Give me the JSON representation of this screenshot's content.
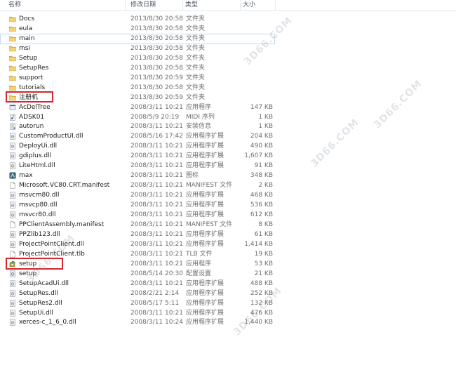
{
  "columns": {
    "name": "名称",
    "date": "修改日期",
    "type": "类型",
    "size": "大小"
  },
  "files": [
    {
      "name": "Docs",
      "date": "2013/8/30 20:58",
      "type": "文件夹",
      "size": "",
      "icon": "folder-icon"
    },
    {
      "name": "eula",
      "date": "2013/8/30 20:58",
      "type": "文件夹",
      "size": "",
      "icon": "folder-icon"
    },
    {
      "name": "main",
      "date": "2013/8/30 20:58",
      "type": "文件夹",
      "size": "",
      "icon": "folder-icon"
    },
    {
      "name": "msi",
      "date": "2013/8/30 20:58",
      "type": "文件夹",
      "size": "",
      "icon": "folder-icon"
    },
    {
      "name": "Setup",
      "date": "2013/8/30 20:58",
      "type": "文件夹",
      "size": "",
      "icon": "folder-icon"
    },
    {
      "name": "SetupRes",
      "date": "2013/8/30 20:58",
      "type": "文件夹",
      "size": "",
      "icon": "folder-icon"
    },
    {
      "name": "support",
      "date": "2013/8/30 20:59",
      "type": "文件夹",
      "size": "",
      "icon": "folder-icon"
    },
    {
      "name": "tutorials",
      "date": "2013/8/30 20:58",
      "type": "文件夹",
      "size": "",
      "icon": "folder-icon"
    },
    {
      "name": "注册机",
      "date": "2013/8/30 20:59",
      "type": "文件夹",
      "size": "",
      "icon": "folder-icon"
    },
    {
      "name": "AcDelTree",
      "date": "2008/3/11 10:21",
      "type": "应用程序",
      "size": "147 KB",
      "icon": "app-icon"
    },
    {
      "name": "ADSK01",
      "date": "2008/5/9 20:19",
      "type": "MIDI 序列",
      "size": "1 KB",
      "icon": "midi-icon"
    },
    {
      "name": "autorun",
      "date": "2008/3/11 10:21",
      "type": "安装信息",
      "size": "1 KB",
      "icon": "setup-info-icon"
    },
    {
      "name": "CustomProductUI.dll",
      "date": "2008/5/16 17:42",
      "type": "应用程序扩展",
      "size": "204 KB",
      "icon": "dll-icon"
    },
    {
      "name": "DeployUi.dll",
      "date": "2008/3/11 10:21",
      "type": "应用程序扩展",
      "size": "490 KB",
      "icon": "dll-icon"
    },
    {
      "name": "gdiplus.dll",
      "date": "2008/3/11 10:21",
      "type": "应用程序扩展",
      "size": "1,607 KB",
      "icon": "dll-icon"
    },
    {
      "name": "LiteHtml.dll",
      "date": "2008/3/11 10:21",
      "type": "应用程序扩展",
      "size": "91 KB",
      "icon": "dll-icon"
    },
    {
      "name": "max",
      "date": "2008/3/11 10:21",
      "type": "图标",
      "size": "348 KB",
      "icon": "max-icon"
    },
    {
      "name": "Microsoft.VC80.CRT.manifest",
      "date": "2008/3/11 10:21",
      "type": "MANIFEST 文件",
      "size": "2 KB",
      "icon": "file-icon"
    },
    {
      "name": "msvcm80.dll",
      "date": "2008/3/11 10:21",
      "type": "应用程序扩展",
      "size": "468 KB",
      "icon": "dll-icon"
    },
    {
      "name": "msvcp80.dll",
      "date": "2008/3/11 10:21",
      "type": "应用程序扩展",
      "size": "536 KB",
      "icon": "dll-icon"
    },
    {
      "name": "msvcr80.dll",
      "date": "2008/3/11 10:21",
      "type": "应用程序扩展",
      "size": "612 KB",
      "icon": "dll-icon"
    },
    {
      "name": "PPClientAssembly.manifest",
      "date": "2008/3/11 10:21",
      "type": "MANIFEST 文件",
      "size": "8 KB",
      "icon": "file-icon"
    },
    {
      "name": "PPZlib123.dll",
      "date": "2008/3/11 10:21",
      "type": "应用程序扩展",
      "size": "61 KB",
      "icon": "dll-icon"
    },
    {
      "name": "ProjectPointClient.dll",
      "date": "2008/3/11 10:21",
      "type": "应用程序扩展",
      "size": "1,414 KB",
      "icon": "dll-icon"
    },
    {
      "name": "ProjectPointClient.tlb",
      "date": "2008/3/11 10:21",
      "type": "TLB 文件",
      "size": "19 KB",
      "icon": "file-icon"
    },
    {
      "name": "setup",
      "date": "2008/3/11 10:21",
      "type": "应用程序",
      "size": "53 KB",
      "icon": "setup-exe-icon"
    },
    {
      "name": "setup",
      "date": "2008/5/14 20:30",
      "type": "配置设置",
      "size": "21 KB",
      "icon": "config-icon"
    },
    {
      "name": "SetupAcadUi.dll",
      "date": "2008/3/11 10:21",
      "type": "应用程序扩展",
      "size": "488 KB",
      "icon": "dll-icon"
    },
    {
      "name": "SetupRes.dll",
      "date": "2008/2/21 2:14",
      "type": "应用程序扩展",
      "size": "252 KB",
      "icon": "dll-icon"
    },
    {
      "name": "SetupRes2.dll",
      "date": "2008/5/17 5:11",
      "type": "应用程序扩展",
      "size": "132 KB",
      "icon": "dll-icon"
    },
    {
      "name": "SetupUi.dll",
      "date": "2008/3/11 10:21",
      "type": "应用程序扩展",
      "size": "476 KB",
      "icon": "dll-icon"
    },
    {
      "name": "xerces-c_1_6_0.dll",
      "date": "2008/3/11 10:24",
      "type": "应用程序扩展",
      "size": "1,440 KB",
      "icon": "dll-icon"
    }
  ],
  "colors": {
    "highlight": "#d4262b",
    "folder": "#e8c15a",
    "header_text": "#4a5563"
  }
}
